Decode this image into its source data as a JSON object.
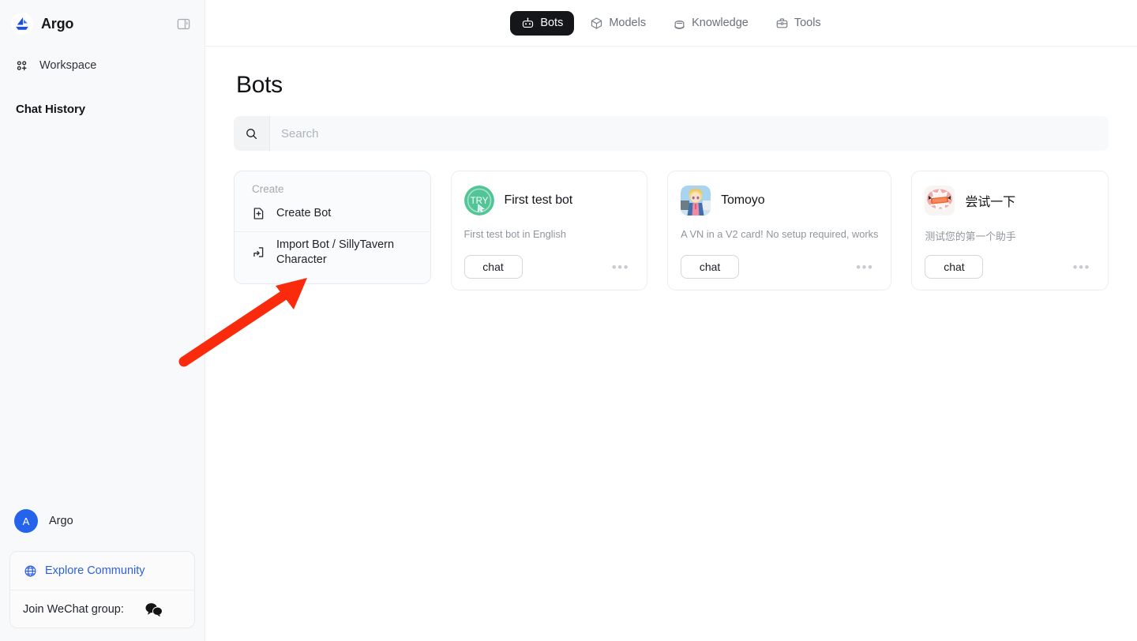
{
  "sidebar": {
    "brand": "Argo",
    "logo_icon": "argo-sailboat-logo",
    "panel_toggle_icon": "sidebar-panel-toggle-icon",
    "nav": [
      {
        "label": "Workspace",
        "icon": "workspace-grid-plus-icon"
      }
    ],
    "section_title": "Chat History",
    "user": {
      "avatar_initial": "A",
      "name": "Argo"
    },
    "explore": {
      "label": "Explore Community",
      "icon": "globe-icon",
      "color": "#2b5fe3"
    },
    "wechat": {
      "label": "Join WeChat group:",
      "icon": "wechat-icon"
    }
  },
  "topnav": {
    "tabs": [
      {
        "label": "Bots",
        "icon": "robot-icon",
        "active": true
      },
      {
        "label": "Models",
        "icon": "cube-icon",
        "active": false
      },
      {
        "label": "Knowledge",
        "icon": "database-icon",
        "active": false
      },
      {
        "label": "Tools",
        "icon": "briefcase-icon",
        "active": false
      }
    ]
  },
  "main": {
    "page_title": "Bots",
    "search": {
      "placeholder": "Search",
      "value": "",
      "icon": "search-icon"
    },
    "create_card": {
      "title": "Create",
      "items": [
        {
          "label": "Create Bot",
          "icon": "file-plus-icon"
        },
        {
          "label": "Import Bot / SillyTavern Character",
          "icon": "import-arrow-icon"
        }
      ]
    },
    "bots": [
      {
        "name": "First test bot",
        "description": "First test bot in English",
        "chat_label": "chat",
        "menu_icon": "ellipsis-icon",
        "avatar": {
          "type": "try-badge",
          "text": "TRY",
          "color": "#3fbd85",
          "shape": "round"
        }
      },
      {
        "name": "Tomoyo",
        "description": "A VN in a V2 card! No setup required, works",
        "chat_label": "chat",
        "menu_icon": "ellipsis-icon",
        "avatar": {
          "type": "anime-portrait",
          "text": "",
          "color": "#7ec0e8",
          "shape": "rounded"
        }
      },
      {
        "name": "尝试一下",
        "description": "测试您的第一个助手",
        "chat_label": "chat",
        "menu_icon": "ellipsis-icon",
        "avatar": {
          "type": "burst-badge",
          "text": "第一款",
          "color": "#f2622c",
          "shape": "rounded"
        }
      }
    ]
  },
  "annotation": {
    "arrow_color": "#fa2a0c",
    "arrow_name": "red-pointer-arrow"
  }
}
